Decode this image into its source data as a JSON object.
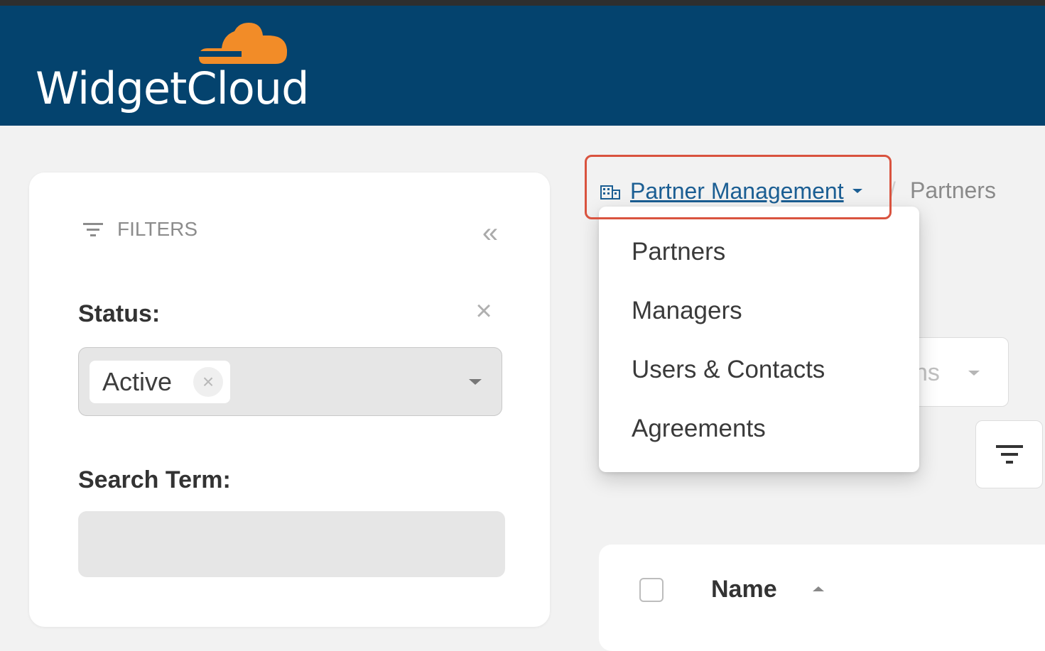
{
  "app": {
    "name": "WidgetCloud",
    "brand_color": "#04436e",
    "accent_color": "#f28c28"
  },
  "breadcrumb": {
    "section": "Partner Management",
    "current": "Partners",
    "separator": "/",
    "icon": "building-icon"
  },
  "dropdown": {
    "items": [
      "Partners",
      "Managers",
      "Users & Contacts",
      "Agreements"
    ]
  },
  "filters": {
    "title": "FILTERS",
    "collapse_glyph": "«",
    "status": {
      "label": "Status:",
      "chips": [
        "Active"
      ]
    },
    "search": {
      "label": "Search Term:",
      "value": "",
      "placeholder": ""
    }
  },
  "toolbar": {
    "actions_partial": "ns"
  },
  "table": {
    "columns": [
      "Name"
    ]
  }
}
